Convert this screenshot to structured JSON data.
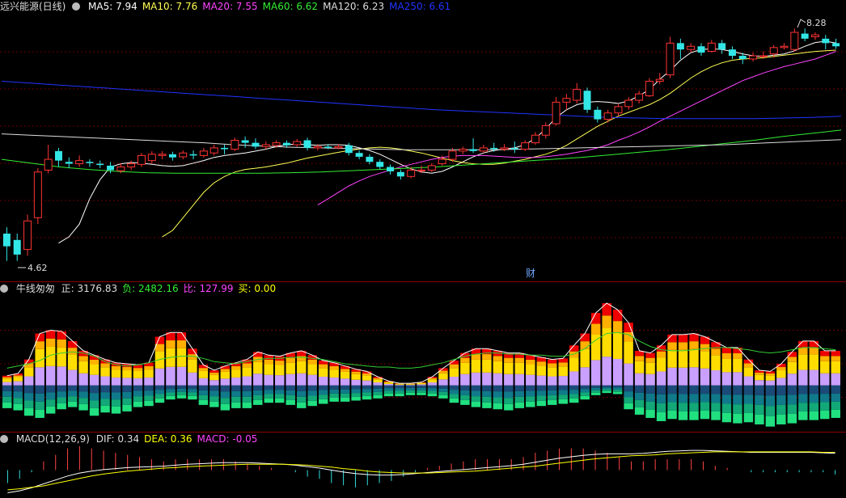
{
  "main": {
    "title": "远兴能源(日线)",
    "ma": [
      {
        "label": "MA5: 7.94",
        "color": "#ffffff"
      },
      {
        "label": "MA10: 7.76",
        "color": "#ffff55"
      },
      {
        "label": "MA20: 7.55",
        "color": "#ff44ff"
      },
      {
        "label": "MA60: 6.62",
        "color": "#33ee33"
      },
      {
        "label": "MA120: 6.23",
        "color": "#dddddd"
      },
      {
        "label": "MA250: 6.61",
        "color": "#2233ff"
      }
    ],
    "high_label": "8.28",
    "low_label": "4.62",
    "marker": "财"
  },
  "volume_panel": {
    "title": "牛线匆匆",
    "items": [
      {
        "label": "正: 3176.83",
        "color": "#dddddd"
      },
      {
        "label": "负: 2482.16",
        "color": "#33ee33"
      },
      {
        "label": "比: 127.99",
        "color": "#ff44ff"
      },
      {
        "label": "买: 0.00",
        "color": "#ffff00"
      }
    ]
  },
  "macd_panel": {
    "title": "MACD(12,26,9)",
    "items": [
      {
        "label": "DIF: 0.34",
        "color": "#dddddd"
      },
      {
        "label": "DEA: 0.36",
        "color": "#ffff00"
      },
      {
        "label": "MACD: -0.05",
        "color": "#ff44ff"
      }
    ]
  },
  "chart_data": [
    {
      "type": "candlestick",
      "ylim": [
        4.4,
        8.5
      ],
      "candles": [
        [
          5.05,
          4.85,
          5.15,
          4.62
        ],
        [
          4.95,
          4.72,
          5.05,
          4.62
        ],
        [
          4.8,
          5.25,
          5.35,
          4.7
        ],
        [
          5.3,
          6.02,
          6.08,
          5.2
        ],
        [
          6.05,
          6.22,
          6.45,
          6.0
        ],
        [
          6.35,
          6.2,
          6.4,
          6.1
        ],
        [
          6.18,
          6.15,
          6.25,
          6.08
        ],
        [
          6.15,
          6.2,
          6.28,
          6.1
        ],
        [
          6.18,
          6.16,
          6.22,
          6.1
        ],
        [
          6.15,
          6.13,
          6.2,
          6.08
        ],
        [
          6.12,
          6.05,
          6.18,
          6.0
        ],
        [
          6.04,
          6.1,
          6.16,
          6.0
        ],
        [
          6.1,
          6.15,
          6.2,
          6.05
        ],
        [
          6.14,
          6.28,
          6.32,
          6.1
        ],
        [
          6.2,
          6.3,
          6.35,
          6.15
        ],
        [
          6.28,
          6.3,
          6.35,
          6.22
        ],
        [
          6.3,
          6.25,
          6.34,
          6.2
        ],
        [
          6.26,
          6.32,
          6.36,
          6.22
        ],
        [
          6.3,
          6.28,
          6.36,
          6.22
        ],
        [
          6.28,
          6.35,
          6.4,
          6.25
        ],
        [
          6.32,
          6.4,
          6.45,
          6.28
        ],
        [
          6.4,
          6.38,
          6.45,
          6.3
        ],
        [
          6.38,
          6.52,
          6.56,
          6.35
        ],
        [
          6.52,
          6.48,
          6.58,
          6.4
        ],
        [
          6.48,
          6.42,
          6.55,
          6.38
        ],
        [
          6.42,
          6.45,
          6.5,
          6.38
        ],
        [
          6.44,
          6.48,
          6.52,
          6.4
        ],
        [
          6.48,
          6.44,
          6.52,
          6.4
        ],
        [
          6.45,
          6.5,
          6.54,
          6.42
        ],
        [
          6.52,
          6.4,
          6.56,
          6.36
        ],
        [
          6.4,
          6.42,
          6.46,
          6.36
        ],
        [
          6.42,
          6.4,
          6.46,
          6.38
        ],
        [
          6.4,
          6.42,
          6.46,
          6.38
        ],
        [
          6.44,
          6.32,
          6.48,
          6.28
        ],
        [
          6.32,
          6.26,
          6.36,
          6.22
        ],
        [
          6.26,
          6.18,
          6.3,
          6.14
        ],
        [
          6.18,
          6.1,
          6.22,
          6.06
        ],
        [
          6.1,
          6.03,
          6.14,
          5.98
        ],
        [
          6.02,
          5.95,
          6.06,
          5.9
        ],
        [
          5.95,
          6.05,
          6.1,
          5.92
        ],
        [
          6.05,
          6.05,
          6.12,
          6.0
        ],
        [
          6.05,
          6.12,
          6.16,
          6.02
        ],
        [
          6.15,
          6.22,
          6.28,
          6.12
        ],
        [
          6.22,
          6.35,
          6.4,
          6.18
        ],
        [
          6.35,
          6.38,
          6.42,
          6.3
        ],
        [
          6.38,
          6.35,
          6.55,
          6.32
        ],
        [
          6.35,
          6.4,
          6.45,
          6.32
        ],
        [
          6.4,
          6.38,
          6.48,
          6.34
        ],
        [
          6.38,
          6.4,
          6.46,
          6.35
        ],
        [
          6.4,
          6.38,
          6.5,
          6.32
        ],
        [
          6.38,
          6.48,
          6.52,
          6.35
        ],
        [
          6.48,
          6.6,
          6.65,
          6.45
        ],
        [
          6.6,
          6.75,
          6.8,
          6.55
        ],
        [
          6.78,
          7.12,
          7.2,
          6.75
        ],
        [
          7.12,
          7.18,
          7.25,
          7.0
        ],
        [
          7.15,
          7.32,
          7.42,
          7.1
        ],
        [
          7.3,
          7.0,
          7.35,
          6.95
        ],
        [
          7.0,
          6.85,
          7.05,
          6.8
        ],
        [
          6.85,
          6.95,
          7.0,
          6.8
        ],
        [
          6.95,
          7.05,
          7.1,
          6.9
        ],
        [
          7.05,
          7.15,
          7.2,
          7.0
        ],
        [
          7.15,
          7.25,
          7.3,
          7.1
        ],
        [
          7.22,
          7.45,
          7.5,
          7.2
        ],
        [
          7.45,
          7.48,
          7.58,
          7.4
        ],
        [
          7.55,
          8.05,
          8.15,
          7.5
        ],
        [
          8.05,
          7.95,
          8.12,
          7.8
        ],
        [
          7.95,
          8.0,
          8.05,
          7.9
        ],
        [
          8.0,
          7.9,
          8.05,
          7.85
        ],
        [
          7.92,
          8.05,
          8.1,
          7.9
        ],
        [
          8.05,
          7.95,
          8.1,
          7.88
        ],
        [
          7.95,
          7.85,
          8.0,
          7.8
        ],
        [
          7.85,
          7.8,
          7.9,
          7.72
        ],
        [
          7.8,
          7.85,
          7.9,
          7.76
        ],
        [
          7.85,
          7.85,
          7.92,
          7.8
        ],
        [
          7.88,
          7.98,
          8.02,
          7.82
        ],
        [
          7.98,
          8.0,
          8.05,
          7.95
        ],
        [
          7.95,
          8.22,
          8.28,
          7.92
        ],
        [
          8.2,
          8.12,
          8.28,
          8.08
        ],
        [
          8.15,
          8.18,
          8.22,
          8.1
        ],
        [
          8.12,
          8.05,
          8.18,
          7.95
        ],
        [
          8.05,
          8.0,
          8.12,
          7.96
        ]
      ],
      "ma_series": [
        {
          "name": "MA5",
          "color": "#ffffff",
          "values": [
            4.9,
            5.0,
            5.2,
            5.6,
            5.9,
            6.1,
            6.15,
            6.17,
            6.16,
            6.14,
            6.12,
            6.11,
            6.12,
            6.16,
            6.2,
            6.25,
            6.28,
            6.3,
            6.32,
            6.35,
            6.38,
            6.42,
            6.45,
            6.46,
            6.45,
            6.44,
            6.45,
            6.45,
            6.44,
            6.4,
            6.36,
            6.3,
            6.22,
            6.14,
            6.07,
            6.02,
            6.0,
            6.03,
            6.1,
            6.18,
            6.26,
            6.32,
            6.36,
            6.38,
            6.4,
            6.45,
            6.55,
            6.7,
            6.88,
            7.0,
            7.08,
            7.12,
            7.13,
            7.12,
            7.1,
            7.14,
            7.22,
            7.32,
            7.48,
            7.62,
            7.78,
            7.9,
            7.95,
            7.96,
            7.95,
            7.92,
            7.88,
            7.85,
            7.84,
            7.86,
            7.88,
            7.93,
            8.0,
            8.06,
            8.08,
            8.05
          ]
        },
        {
          "name": "MA10",
          "color": "#ffff55",
          "values": [
            5.0,
            5.1,
            5.3,
            5.5,
            5.7,
            5.85,
            5.95,
            6.02,
            6.06,
            6.08,
            6.1,
            6.13,
            6.16,
            6.2,
            6.24,
            6.27,
            6.3,
            6.33,
            6.36,
            6.38,
            6.4,
            6.41,
            6.4,
            6.38,
            6.35,
            6.32,
            6.28,
            6.24,
            6.2,
            6.17,
            6.15,
            6.14,
            6.14,
            6.16,
            6.19,
            6.22,
            6.26,
            6.3,
            6.36,
            6.44,
            6.54,
            6.64,
            6.74,
            6.82,
            6.9,
            6.96,
            7.02,
            7.08,
            7.16,
            7.26,
            7.38,
            7.5,
            7.6,
            7.68,
            7.74,
            7.78,
            7.8,
            7.81,
            7.82,
            7.84,
            7.86,
            7.88,
            7.9,
            7.92,
            7.93,
            7.94
          ]
        },
        {
          "name": "MA20",
          "color": "#ff44ff",
          "values": [
            5.5,
            5.6,
            5.7,
            5.8,
            5.88,
            5.95,
            6.0,
            6.05,
            6.1,
            6.14,
            6.18,
            6.22,
            6.25,
            6.27,
            6.28,
            6.28,
            6.28,
            6.27,
            6.26,
            6.25,
            6.25,
            6.25,
            6.26,
            6.28,
            6.3,
            6.33,
            6.36,
            6.4,
            6.45,
            6.52,
            6.58,
            6.65,
            6.73,
            6.82,
            6.9,
            6.98,
            7.06,
            7.14,
            7.22,
            7.3,
            7.38,
            7.46,
            7.52,
            7.58,
            7.63,
            7.68,
            7.72,
            7.76,
            7.8,
            7.86,
            7.92
          ]
        },
        {
          "name": "MA60",
          "color": "#33ee33",
          "values": [
            6.22,
            6.16,
            6.1,
            6.06,
            6.03,
            6.01,
            6.0,
            6.0,
            6.0,
            6.0,
            6.01,
            6.02,
            6.04,
            6.06,
            6.08,
            6.1,
            6.13,
            6.16,
            6.19,
            6.22,
            6.25,
            6.29,
            6.33,
            6.37,
            6.42,
            6.47,
            6.52,
            6.58,
            6.63,
            6.68
          ]
        },
        {
          "name": "MA120",
          "color": "#dddddd",
          "values": [
            6.62,
            6.6,
            6.58,
            6.56,
            6.54,
            6.52,
            6.5,
            6.48,
            6.45,
            6.43,
            6.41,
            6.4,
            6.39,
            6.38,
            6.37,
            6.37,
            6.37,
            6.37,
            6.38,
            6.39,
            6.4,
            6.41,
            6.42,
            6.43,
            6.44,
            6.45,
            6.47,
            6.49,
            6.51,
            6.53
          ]
        },
        {
          "name": "MA250",
          "color": "#2233ff",
          "values": [
            7.45,
            7.42,
            7.39,
            7.36,
            7.33,
            7.3,
            7.27,
            7.24,
            7.21,
            7.18,
            7.15,
            7.12,
            7.09,
            7.06,
            7.03,
            7.0,
            6.98,
            6.96,
            6.94,
            6.92,
            6.9,
            6.88,
            6.87,
            6.86,
            6.86,
            6.86,
            6.86,
            6.87,
            6.88,
            6.9
          ]
        }
      ]
    },
    {
      "type": "bar",
      "name": "牛线匆匆",
      "pos": [
        0.9,
        1.1,
        2.4,
        4.8,
        5.1,
        5.0,
        4.1,
        3.2,
        2.8,
        2.4,
        2.1,
        2.0,
        1.9,
        2.1,
        4.5,
        4.9,
        4.9,
        3.4,
        1.9,
        1.4,
        1.8,
        2.1,
        2.4,
        3.1,
        2.8,
        2.7,
        3.0,
        3.2,
        2.8,
        2.3,
        2.1,
        1.8,
        1.5,
        1.3,
        0.8,
        0.4,
        0.2,
        0.2,
        0.3,
        0.8,
        1.6,
        2.3,
        3.0,
        3.4,
        3.4,
        3.2,
        3.0,
        3.0,
        2.8,
        2.6,
        2.4,
        2.5,
        3.7,
        4.8,
        6.7,
        7.6,
        7.0,
        5.8,
        3.2,
        3.0,
        3.7,
        4.7,
        4.7,
        4.8,
        4.5,
        4.0,
        3.5,
        3.5,
        2.4,
        1.4,
        1.3,
        2.0,
        3.1,
        4.1,
        4.1,
        3.2,
        3.2
      ],
      "neg": [
        2.1,
        2.3,
        2.8,
        3.0,
        2.6,
        2.2,
        2.0,
        2.3,
        2.8,
        2.5,
        2.6,
        2.4,
        2.0,
        1.9,
        1.6,
        1.3,
        1.2,
        1.3,
        1.8,
        2.0,
        2.3,
        2.1,
        2.1,
        1.8,
        1.6,
        1.6,
        1.8,
        2.1,
        1.9,
        1.7,
        1.5,
        1.5,
        1.4,
        1.3,
        1.2,
        1.0,
        1.0,
        0.9,
        0.9,
        1.0,
        1.2,
        1.6,
        1.8,
        2.0,
        2.1,
        2.2,
        2.3,
        2.1,
        2.0,
        1.9,
        1.8,
        1.7,
        1.6,
        1.3,
        0.9,
        0.7,
        0.8,
        2.2,
        2.7,
        3.0,
        3.3,
        3.1,
        3.2,
        3.2,
        3.1,
        3.2,
        3.4,
        3.5,
        3.4,
        3.6,
        3.8,
        3.6,
        3.5,
        3.2,
        3.2,
        3.1,
        3.0
      ],
      "line": [
        1.6,
        1.8,
        2.0,
        2.3,
        2.8,
        3.0,
        3.1,
        3.0,
        2.7,
        2.2,
        1.9,
        1.8,
        1.9,
        2.1,
        2.4,
        2.6,
        2.7,
        2.7,
        2.5,
        2.2,
        2.1,
        2.0,
        2.2,
        2.4,
        2.5,
        2.5,
        2.6,
        2.6,
        2.5,
        2.4,
        2.2,
        2.0,
        1.9,
        1.8,
        1.7,
        1.7,
        1.6,
        1.6,
        1.7,
        1.9,
        2.1,
        2.4,
        2.7,
        2.9,
        3.0,
        3.0,
        2.9,
        2.9,
        2.8,
        2.8,
        2.7,
        2.7,
        2.9,
        3.4,
        4.2,
        4.8,
        4.9,
        4.7,
        4.1,
        3.6,
        3.3,
        3.2,
        3.2,
        3.3,
        3.4,
        3.5,
        3.5,
        3.4,
        3.3,
        3.1,
        3.0,
        3.1,
        3.3,
        3.5,
        3.5,
        3.4,
        3.3
      ],
      "ylim": [
        -4.2,
        8.2
      ]
    },
    {
      "type": "line",
      "name": "MACD(12,26,9)",
      "dif": [
        -0.46,
        -0.42,
        -0.36,
        -0.28,
        -0.2,
        -0.12,
        -0.06,
        -0.02,
        0.01,
        0.03,
        0.05,
        0.06,
        0.07,
        0.08,
        0.1,
        0.12,
        0.13,
        0.14,
        0.15,
        0.15,
        0.15,
        0.14,
        0.13,
        0.12,
        0.1,
        0.07,
        0.04,
        0.0,
        -0.04,
        -0.07,
        -0.09,
        -0.1,
        -0.1,
        -0.09,
        -0.07,
        -0.05,
        -0.03,
        -0.01,
        0.01,
        0.03,
        0.05,
        0.07,
        0.09,
        0.12,
        0.16,
        0.2,
        0.24,
        0.27,
        0.3,
        0.32,
        0.33,
        0.33,
        0.33,
        0.34,
        0.36,
        0.38,
        0.39,
        0.4,
        0.4,
        0.39,
        0.38,
        0.37,
        0.36,
        0.36,
        0.36,
        0.36,
        0.36,
        0.36,
        0.35,
        0.34
      ],
      "dea": [
        -0.4,
        -0.38,
        -0.35,
        -0.32,
        -0.27,
        -0.22,
        -0.17,
        -0.12,
        -0.08,
        -0.05,
        -0.02,
        0.0,
        0.02,
        0.04,
        0.05,
        0.07,
        0.08,
        0.09,
        0.1,
        0.11,
        0.12,
        0.12,
        0.12,
        0.12,
        0.11,
        0.1,
        0.08,
        0.06,
        0.03,
        0.01,
        -0.02,
        -0.04,
        -0.05,
        -0.06,
        -0.06,
        -0.06,
        -0.05,
        -0.04,
        -0.03,
        -0.02,
        0.0,
        0.02,
        0.04,
        0.06,
        0.08,
        0.11,
        0.14,
        0.17,
        0.2,
        0.23,
        0.25,
        0.27,
        0.29,
        0.3,
        0.31,
        0.33,
        0.34,
        0.35,
        0.36,
        0.37,
        0.37,
        0.37,
        0.37,
        0.37,
        0.37,
        0.37,
        0.37,
        0.37,
        0.36,
        0.36
      ],
      "ylim": [
        -0.55,
        0.5
      ]
    }
  ]
}
